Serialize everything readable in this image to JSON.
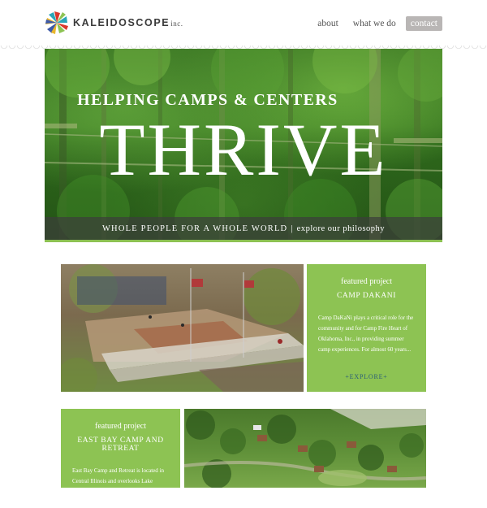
{
  "brand": {
    "name": "KALEIDOSCOPE",
    "suffix": "inc.",
    "logo_icon": "kaleidoscope-pinwheel-icon",
    "logo_colors": [
      "#d9382c",
      "#2aa6b8",
      "#8dc353",
      "#3e5aa8",
      "#e8b62d"
    ]
  },
  "nav": {
    "items": [
      {
        "label": "about"
      },
      {
        "label": "what we do"
      },
      {
        "label": "contact"
      }
    ],
    "active_index": 2
  },
  "hero": {
    "headline_top": "HELPING CAMPS & CENTERS",
    "headline_big": "THRIVE",
    "tagline": "WHOLE PEOPLE FOR A WHOLE WORLD",
    "separator": "|",
    "link": "explore our philosophy"
  },
  "projects": [
    {
      "kicker": "featured project",
      "title": "CAMP DAKANI",
      "body": "Camp DaKaNi plays a critical role for the community and for Camp Fire Heart of Oklahoma, Inc., in providing summer camp experiences. For almost 60 years...",
      "link": "+EXPLORE+"
    },
    {
      "kicker": "featured project",
      "title": "EAST BAY CAMP AND RETREAT",
      "body": "East Bay Camp and Retreat is located in Central Illinois and overlooks Lake Bloomington. The property has great physical and natural assets from which to",
      "link": ""
    }
  ],
  "colors": {
    "accent_green": "#8dc353",
    "nav_active_bg": "#b9b6b5",
    "link_blue": "#2c5e78"
  }
}
